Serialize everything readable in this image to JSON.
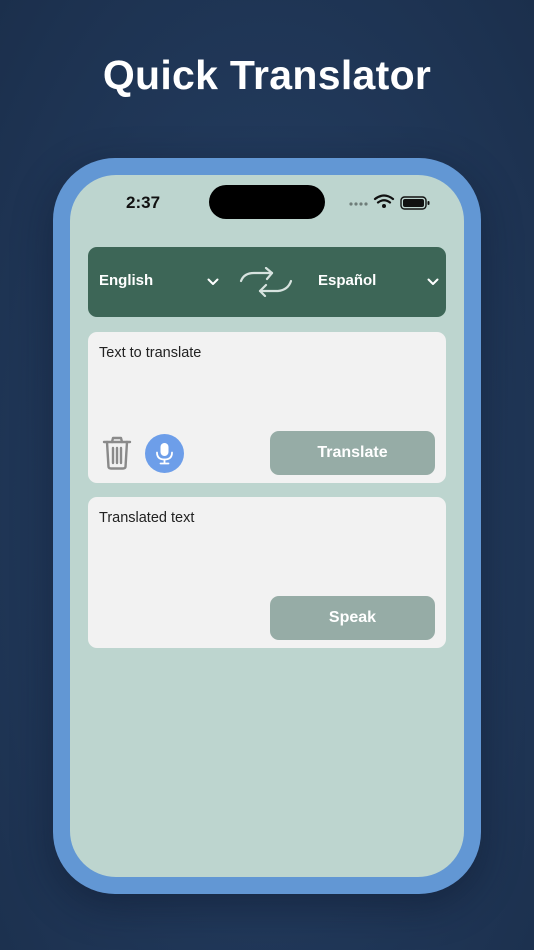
{
  "headline": "Quick Translator",
  "status_bar": {
    "time": "2:37"
  },
  "language_bar": {
    "source_language": "English",
    "target_language": "Español"
  },
  "input_card": {
    "placeholder": "Text to translate",
    "translate_label": "Translate"
  },
  "output_card": {
    "placeholder": "Translated text",
    "speak_label": "Speak"
  },
  "icons": {
    "swap": "swap-arrows-icon",
    "trash": "trash-icon",
    "mic": "microphone-icon",
    "chevron": "chevron-down-icon"
  },
  "colors": {
    "background": "#223a5c",
    "phone_frame": "#6297d4",
    "screen": "#bdd5cf",
    "language_bar": "#3d6657",
    "card": "#f2f2f2",
    "button": "#96aca6",
    "mic_button": "#6d9ee9"
  }
}
